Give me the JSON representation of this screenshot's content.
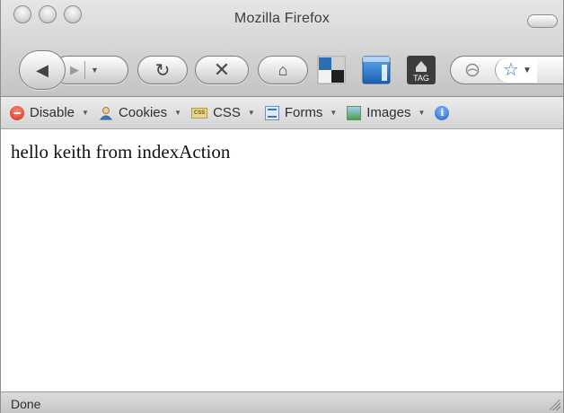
{
  "window": {
    "title": "Mozilla Firefox"
  },
  "toolbar": {
    "back_icon": "◀",
    "forward_icon": "▶",
    "forward_dropdown_icon": "▼",
    "reload_icon": "↻",
    "stop_icon": "✕",
    "home_icon": "⌂",
    "tag_label": "TAG",
    "bookmark_star_icon": "☆",
    "url_dropdown_icon": "▼"
  },
  "devbar": {
    "items": [
      {
        "label": "Disable",
        "icon": "disable-icon"
      },
      {
        "label": "Cookies",
        "icon": "cookies-icon"
      },
      {
        "label": "CSS",
        "icon": "css-icon"
      },
      {
        "label": "Forms",
        "icon": "forms-icon"
      },
      {
        "label": "Images",
        "icon": "images-icon"
      }
    ],
    "caret": "▼",
    "css_icon_text": "CSS",
    "info_icon_text": "i"
  },
  "content": {
    "text": "hello keith from indexAction"
  },
  "status": {
    "text": "Done"
  },
  "colors": {
    "star": "#2b6fd1",
    "disable": "#d9281a",
    "info": "#1f5fd0"
  }
}
